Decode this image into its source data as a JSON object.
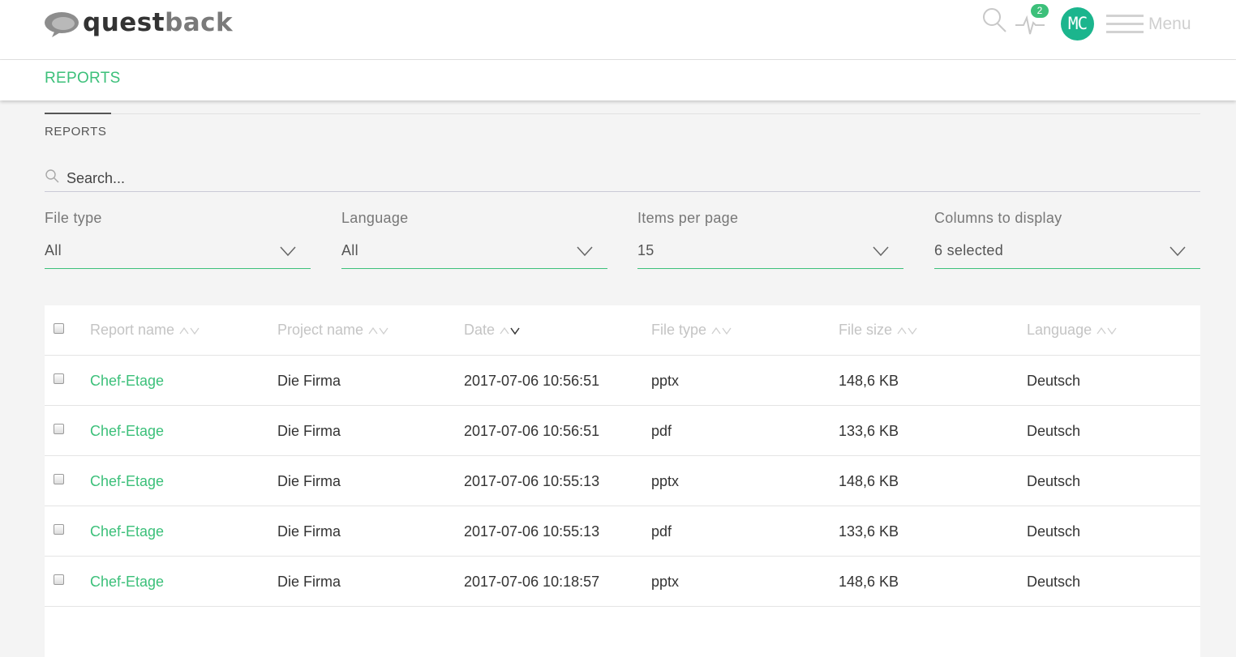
{
  "header": {
    "logo_text_dark": "quest",
    "logo_text_light": "back",
    "notification_count": "2",
    "avatar_initials": "MC",
    "menu_label": "Menu"
  },
  "subnav": {
    "active_link": "REPORTS"
  },
  "section": {
    "title": "REPORTS"
  },
  "search": {
    "placeholder": "Search..."
  },
  "filters": [
    {
      "label": "File type",
      "value": "All"
    },
    {
      "label": "Language",
      "value": "All"
    },
    {
      "label": "Items per page",
      "value": "15"
    },
    {
      "label": "Columns to display",
      "value": "6 selected"
    }
  ],
  "table": {
    "columns": [
      "Report name",
      "Project name",
      "Date",
      "File type",
      "File size",
      "Language"
    ],
    "sorted_column": "Date",
    "rows": [
      [
        "Chef-Etage",
        "Die Firma",
        "2017-07-06 10:56:51",
        "pptx",
        "148,6 KB",
        "Deutsch"
      ],
      [
        "Chef-Etage",
        "Die Firma",
        "2017-07-06 10:56:51",
        "pdf",
        "133,6 KB",
        "Deutsch"
      ],
      [
        "Chef-Etage",
        "Die Firma",
        "2017-07-06 10:55:13",
        "pptx",
        "148,6 KB",
        "Deutsch"
      ],
      [
        "Chef-Etage",
        "Die Firma",
        "2017-07-06 10:55:13",
        "pdf",
        "133,6 KB",
        "Deutsch"
      ],
      [
        "Chef-Etage",
        "Die Firma",
        "2017-07-06 10:18:57",
        "pptx",
        "148,6 KB",
        "Deutsch"
      ]
    ]
  },
  "colors": {
    "accent": "#3cc07a",
    "avatar": "#1bb58d"
  }
}
